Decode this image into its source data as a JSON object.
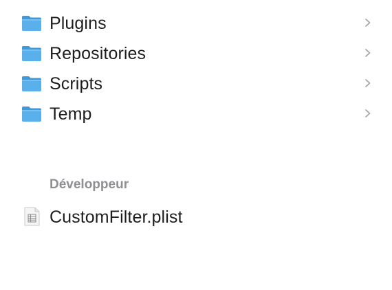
{
  "folders": [
    {
      "label": "Plugins",
      "icon": "folder-icon",
      "chevron": "chevron-right-icon"
    },
    {
      "label": "Repositories",
      "icon": "folder-icon",
      "chevron": "chevron-right-icon"
    },
    {
      "label": "Scripts",
      "icon": "folder-icon",
      "chevron": "chevron-right-icon"
    },
    {
      "label": "Temp",
      "icon": "folder-icon",
      "chevron": "chevron-right-icon"
    }
  ],
  "section": {
    "title": "Développeur"
  },
  "files": [
    {
      "label": "CustomFilter.plist",
      "icon": "plist-file-icon"
    }
  ],
  "colors": {
    "folder_body": "#5ab0ea",
    "folder_tab": "#3f99d9",
    "section_header": "#8e8e93",
    "chevron": "#a1a1a6",
    "text": "#1d1d1f"
  }
}
